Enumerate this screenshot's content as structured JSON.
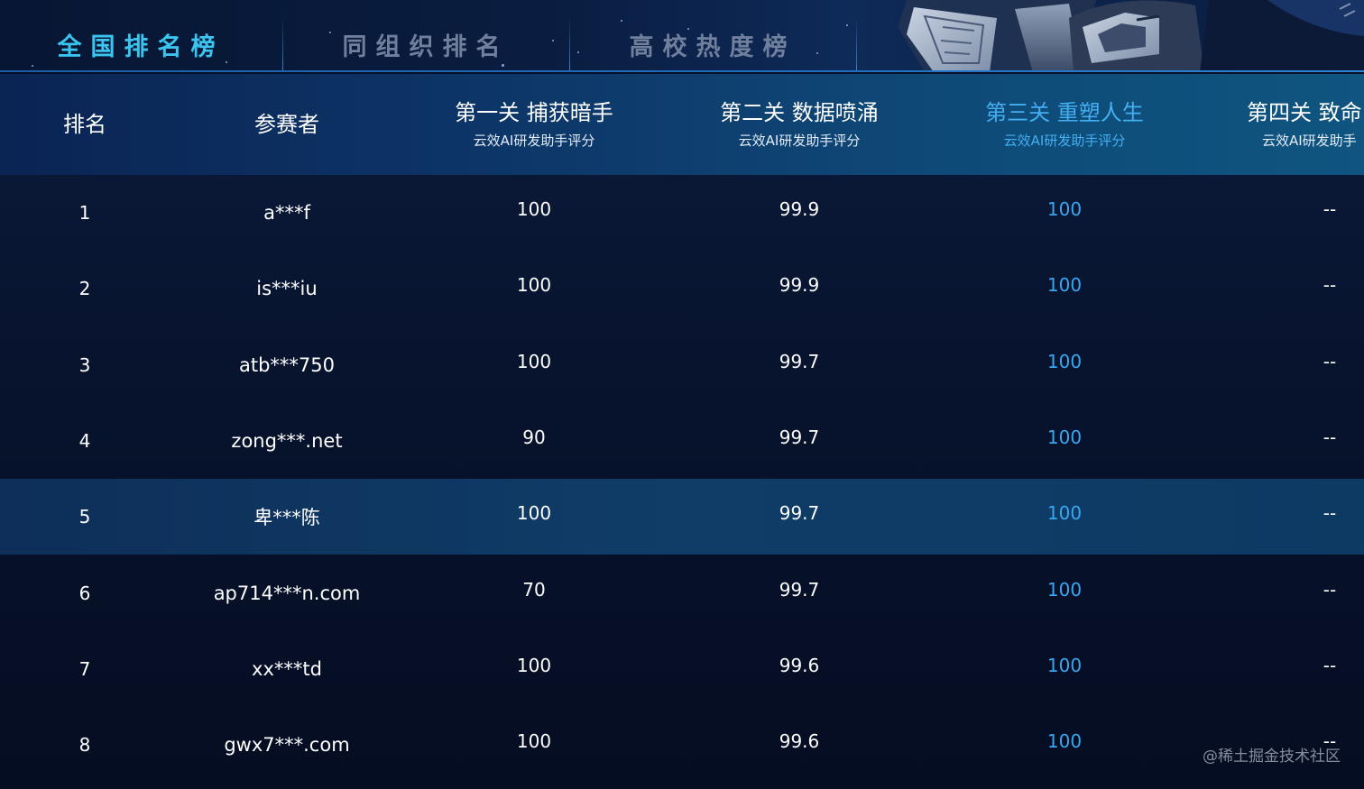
{
  "tabs": [
    {
      "label": "全国排名榜",
      "active": true
    },
    {
      "label": "同组织排名",
      "active": false
    },
    {
      "label": "高校热度榜",
      "active": false
    }
  ],
  "columns": {
    "rank": {
      "title": "排名"
    },
    "participant": {
      "title": "参赛者"
    },
    "stage1": {
      "title": "第一关 捕获暗手",
      "subtitle": "云效AI研发助手评分"
    },
    "stage2": {
      "title": "第二关 数据喷涌",
      "subtitle": "云效AI研发助手评分"
    },
    "stage3": {
      "title": "第三关 重塑人生",
      "subtitle": "云效AI研发助手评分"
    },
    "stage4": {
      "title": "第四关 致命",
      "subtitle": "云效AI研发助手"
    }
  },
  "rows": [
    {
      "rank": "1",
      "participant": "a***f",
      "stage1": "100",
      "stage2": "99.9",
      "stage3": "100",
      "stage4": "--"
    },
    {
      "rank": "2",
      "participant": "is***iu",
      "stage1": "100",
      "stage2": "99.9",
      "stage3": "100",
      "stage4": "--"
    },
    {
      "rank": "3",
      "participant": "atb***750",
      "stage1": "100",
      "stage2": "99.7",
      "stage3": "100",
      "stage4": "--"
    },
    {
      "rank": "4",
      "participant": "zong***.net",
      "stage1": "90",
      "stage2": "99.7",
      "stage3": "100",
      "stage4": "--"
    },
    {
      "rank": "5",
      "participant": "卑***陈",
      "stage1": "100",
      "stage2": "99.7",
      "stage3": "100",
      "stage4": "--"
    },
    {
      "rank": "6",
      "participant": "ap714***n.com",
      "stage1": "70",
      "stage2": "99.7",
      "stage3": "100",
      "stage4": "--"
    },
    {
      "rank": "7",
      "participant": "xx***td",
      "stage1": "100",
      "stage2": "99.6",
      "stage3": "100",
      "stage4": "--"
    },
    {
      "rank": "8",
      "participant": "gwx7***.com",
      "stage1": "100",
      "stage2": "99.6",
      "stage3": "100",
      "stage4": "--"
    }
  ],
  "watermark": "@稀土掘金技术社区",
  "colors": {
    "active_tab": "#3ac4ee",
    "inactive_tab": "#6f7f9c",
    "stage3_accent": "#3aa6f0",
    "selected_row": "#0f3d68"
  }
}
